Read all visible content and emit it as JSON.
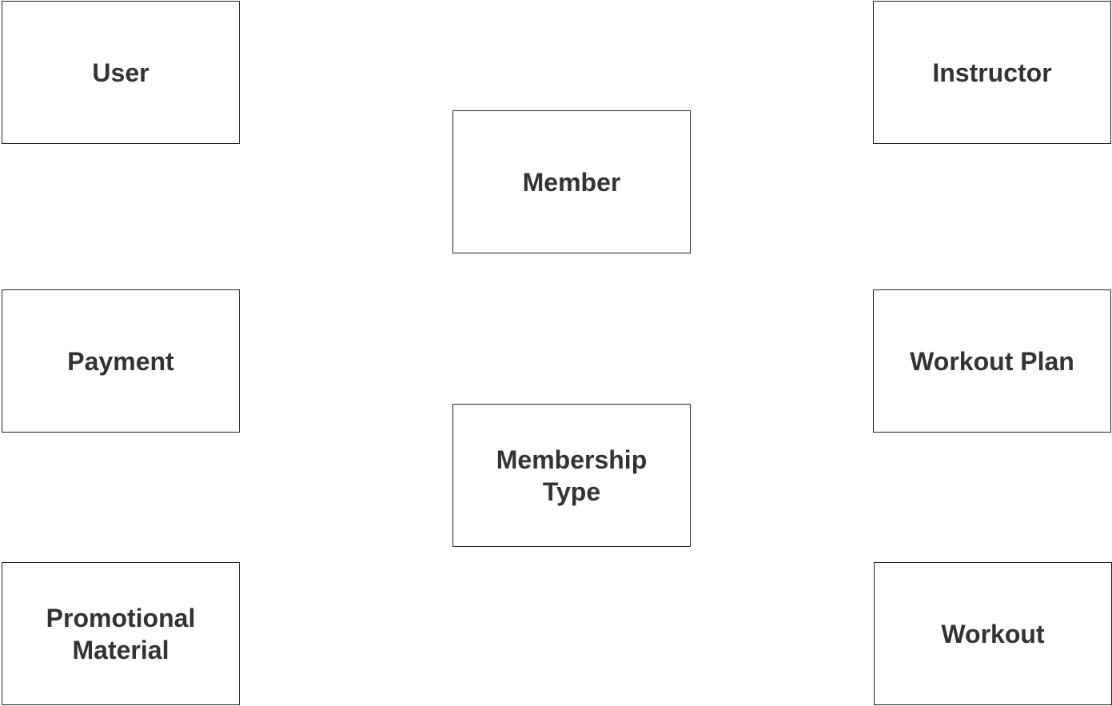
{
  "diagram": {
    "type": "entity-boxes",
    "border_color": "#222222",
    "text_color": "#333333",
    "background": "#ffffff",
    "entities": [
      {
        "id": "user",
        "label": "User"
      },
      {
        "id": "instructor",
        "label": "Instructor"
      },
      {
        "id": "member",
        "label": "Member"
      },
      {
        "id": "payment",
        "label": "Payment"
      },
      {
        "id": "workout_plan",
        "label": "Workout Plan"
      },
      {
        "id": "membership_type",
        "label": "Membership\nType"
      },
      {
        "id": "promotional_material",
        "label": "Promotional\nMaterial"
      },
      {
        "id": "workout",
        "label": "Workout"
      }
    ]
  }
}
